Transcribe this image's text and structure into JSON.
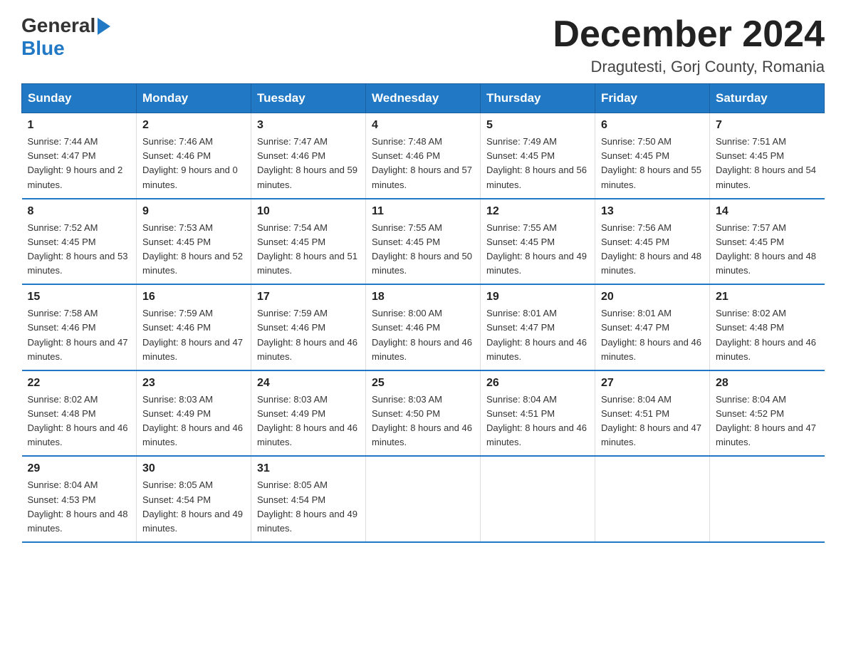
{
  "header": {
    "logo_general": "General",
    "logo_blue": "Blue",
    "month_title": "December 2024",
    "location": "Dragutesti, Gorj County, Romania"
  },
  "columns": [
    "Sunday",
    "Monday",
    "Tuesday",
    "Wednesday",
    "Thursday",
    "Friday",
    "Saturday"
  ],
  "weeks": [
    [
      {
        "day": "1",
        "sunrise": "7:44 AM",
        "sunset": "4:47 PM",
        "daylight": "9 hours and 2 minutes."
      },
      {
        "day": "2",
        "sunrise": "7:46 AM",
        "sunset": "4:46 PM",
        "daylight": "9 hours and 0 minutes."
      },
      {
        "day": "3",
        "sunrise": "7:47 AM",
        "sunset": "4:46 PM",
        "daylight": "8 hours and 59 minutes."
      },
      {
        "day": "4",
        "sunrise": "7:48 AM",
        "sunset": "4:46 PM",
        "daylight": "8 hours and 57 minutes."
      },
      {
        "day": "5",
        "sunrise": "7:49 AM",
        "sunset": "4:45 PM",
        "daylight": "8 hours and 56 minutes."
      },
      {
        "day": "6",
        "sunrise": "7:50 AM",
        "sunset": "4:45 PM",
        "daylight": "8 hours and 55 minutes."
      },
      {
        "day": "7",
        "sunrise": "7:51 AM",
        "sunset": "4:45 PM",
        "daylight": "8 hours and 54 minutes."
      }
    ],
    [
      {
        "day": "8",
        "sunrise": "7:52 AM",
        "sunset": "4:45 PM",
        "daylight": "8 hours and 53 minutes."
      },
      {
        "day": "9",
        "sunrise": "7:53 AM",
        "sunset": "4:45 PM",
        "daylight": "8 hours and 52 minutes."
      },
      {
        "day": "10",
        "sunrise": "7:54 AM",
        "sunset": "4:45 PM",
        "daylight": "8 hours and 51 minutes."
      },
      {
        "day": "11",
        "sunrise": "7:55 AM",
        "sunset": "4:45 PM",
        "daylight": "8 hours and 50 minutes."
      },
      {
        "day": "12",
        "sunrise": "7:55 AM",
        "sunset": "4:45 PM",
        "daylight": "8 hours and 49 minutes."
      },
      {
        "day": "13",
        "sunrise": "7:56 AM",
        "sunset": "4:45 PM",
        "daylight": "8 hours and 48 minutes."
      },
      {
        "day": "14",
        "sunrise": "7:57 AM",
        "sunset": "4:45 PM",
        "daylight": "8 hours and 48 minutes."
      }
    ],
    [
      {
        "day": "15",
        "sunrise": "7:58 AM",
        "sunset": "4:46 PM",
        "daylight": "8 hours and 47 minutes."
      },
      {
        "day": "16",
        "sunrise": "7:59 AM",
        "sunset": "4:46 PM",
        "daylight": "8 hours and 47 minutes."
      },
      {
        "day": "17",
        "sunrise": "7:59 AM",
        "sunset": "4:46 PM",
        "daylight": "8 hours and 46 minutes."
      },
      {
        "day": "18",
        "sunrise": "8:00 AM",
        "sunset": "4:46 PM",
        "daylight": "8 hours and 46 minutes."
      },
      {
        "day": "19",
        "sunrise": "8:01 AM",
        "sunset": "4:47 PM",
        "daylight": "8 hours and 46 minutes."
      },
      {
        "day": "20",
        "sunrise": "8:01 AM",
        "sunset": "4:47 PM",
        "daylight": "8 hours and 46 minutes."
      },
      {
        "day": "21",
        "sunrise": "8:02 AM",
        "sunset": "4:48 PM",
        "daylight": "8 hours and 46 minutes."
      }
    ],
    [
      {
        "day": "22",
        "sunrise": "8:02 AM",
        "sunset": "4:48 PM",
        "daylight": "8 hours and 46 minutes."
      },
      {
        "day": "23",
        "sunrise": "8:03 AM",
        "sunset": "4:49 PM",
        "daylight": "8 hours and 46 minutes."
      },
      {
        "day": "24",
        "sunrise": "8:03 AM",
        "sunset": "4:49 PM",
        "daylight": "8 hours and 46 minutes."
      },
      {
        "day": "25",
        "sunrise": "8:03 AM",
        "sunset": "4:50 PM",
        "daylight": "8 hours and 46 minutes."
      },
      {
        "day": "26",
        "sunrise": "8:04 AM",
        "sunset": "4:51 PM",
        "daylight": "8 hours and 46 minutes."
      },
      {
        "day": "27",
        "sunrise": "8:04 AM",
        "sunset": "4:51 PM",
        "daylight": "8 hours and 47 minutes."
      },
      {
        "day": "28",
        "sunrise": "8:04 AM",
        "sunset": "4:52 PM",
        "daylight": "8 hours and 47 minutes."
      }
    ],
    [
      {
        "day": "29",
        "sunrise": "8:04 AM",
        "sunset": "4:53 PM",
        "daylight": "8 hours and 48 minutes."
      },
      {
        "day": "30",
        "sunrise": "8:05 AM",
        "sunset": "4:54 PM",
        "daylight": "8 hours and 49 minutes."
      },
      {
        "day": "31",
        "sunrise": "8:05 AM",
        "sunset": "4:54 PM",
        "daylight": "8 hours and 49 minutes."
      },
      null,
      null,
      null,
      null
    ]
  ]
}
